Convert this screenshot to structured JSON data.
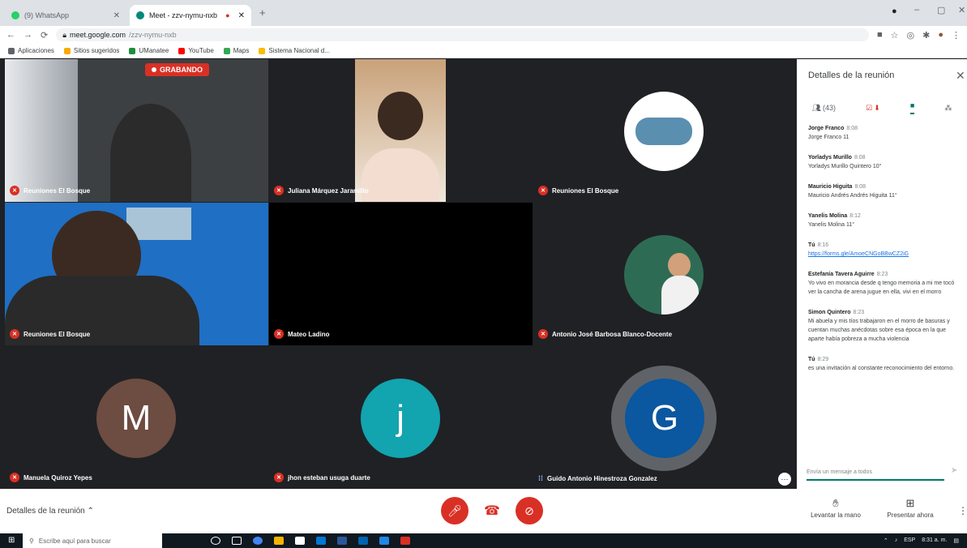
{
  "browser": {
    "tabs": [
      {
        "label": "(9) WhatsApp",
        "active": false,
        "color": "#25d366"
      },
      {
        "label": "Meet - zzv-nymu-nxb",
        "active": true,
        "color": "#00897b"
      }
    ],
    "url_host": "meet.google.com",
    "url_path": "/zzv-nymu-nxb",
    "bookmarks": [
      {
        "label": "Aplicaciones",
        "color": "#5f6368"
      },
      {
        "label": "Sitios sugeridos",
        "color": "#f9ab00"
      },
      {
        "label": "UManatee",
        "color": "#1e8e3e"
      },
      {
        "label": "YouTube",
        "color": "#ff0000"
      },
      {
        "label": "Maps",
        "color": "#34a853"
      },
      {
        "label": "Sistema Nacional d...",
        "color": "#fbbc04"
      }
    ]
  },
  "recording_label": "GRABANDO",
  "participants": [
    {
      "name": "Reuniones El Bosque",
      "muted": true
    },
    {
      "name": "Juliana Márquez Jaramillo",
      "muted": true
    },
    {
      "name": "Reuniones El Bosque",
      "muted": true
    },
    {
      "name": "Reuniones El Bosque",
      "muted": true
    },
    {
      "name": "Mateo Ladino",
      "muted": true
    },
    {
      "name": "Antonio José Barbosa Blanco-Docente",
      "muted": true
    },
    {
      "name": "Manuela Quiroz Yepes",
      "muted": true,
      "initial": "M",
      "color": "#6d4c41"
    },
    {
      "name": "jhon esteban usuga duarte",
      "muted": true,
      "initial": "j",
      "color": "#12a4af"
    },
    {
      "name": "Guido Antonio Hinestroza Gonzalez",
      "muted": false,
      "initial": "G",
      "color": "#0b57a0"
    }
  ],
  "panel": {
    "title": "Detalles de la reunión",
    "people_count": "(43)",
    "messages": [
      {
        "sender": "Jorge Franco",
        "time": "8:08",
        "text": "Jorge Franco 11"
      },
      {
        "sender": "Yorladys Murillo",
        "time": "8:08",
        "text": "Yorladys Murillo Quintero 10°"
      },
      {
        "sender": "Mauricio Higuita",
        "time": "8:08",
        "text": "Mauricio Andrés Andrés Higuita 11°"
      },
      {
        "sender": "Yanelis Molina",
        "time": "8:12",
        "text": "Yanelis Molina 11°"
      },
      {
        "sender": "Tú",
        "time": "8:16",
        "text": "",
        "link": "https://forms.gle/AmoeCNGoBBwCZ2iG"
      },
      {
        "sender": "Estefanía Tavera Aguirre",
        "time": "8:23",
        "text": "Yo vivo en morancia desde q tengo memoria a mi me tocó ver la cancha de arena jugue en ella, vivi en el morro"
      },
      {
        "sender": "Simon Quintero",
        "time": "8:23",
        "text": "Mi abuela y mis tíos trabajaron en el morro de basuras y cuentan muchas anécdotas sobre esa época en la que aparte había pobreza a mucha violencia"
      },
      {
        "sender": "Tú",
        "time": "8:29",
        "text": "es una invitación al constante reconocimiento del entorno."
      }
    ],
    "input_placeholder": "Envía un mensaje a todos"
  },
  "bottom": {
    "details_label": "Detalles de la reunión",
    "raise_hand_label": "Levantar la mano",
    "present_label": "Presentar ahora"
  },
  "taskbar": {
    "search_placeholder": "Escribe aquí para buscar",
    "time": "8:31 a. m.",
    "lang": "ESP"
  },
  "colors": {
    "accent": "#00796b",
    "danger": "#d93025",
    "meet_bg": "#202124"
  }
}
